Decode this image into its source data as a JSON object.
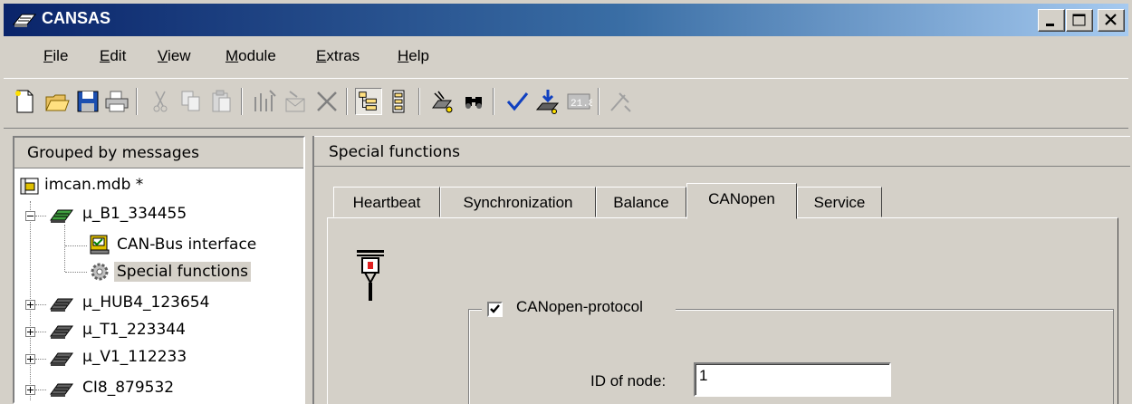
{
  "window": {
    "title": "CANSAS"
  },
  "menu": [
    {
      "label": "File",
      "accel": "F",
      "rest": "ile"
    },
    {
      "label": "Edit",
      "accel": "E",
      "rest": "dit"
    },
    {
      "label": "View",
      "accel": "V",
      "rest": "iew"
    },
    {
      "label": "Module",
      "accel": "M",
      "rest": "odule"
    },
    {
      "label": "Extras",
      "accel": "E",
      "rest": "xtras"
    },
    {
      "label": "Help",
      "accel": "H",
      "rest": "elp"
    }
  ],
  "toolbar": {
    "icons": [
      "new-file-icon",
      "open-folder-icon",
      "save-icon",
      "print-icon",
      "cut-icon",
      "copy-icon",
      "paste-icon",
      "add-module-icon",
      "import-icon",
      "delete-icon",
      "tree-view-icon",
      "list-view-icon",
      "find-module-icon",
      "binoculars-icon",
      "check-icon",
      "download-icon",
      "display-icon",
      "disabled-tool-icon"
    ],
    "pressed": "tree-view-icon"
  },
  "left_panel": {
    "header": "Grouped by messages",
    "tree": [
      {
        "label": "imcan.mdb *",
        "level": 0,
        "icon": "database-icon"
      },
      {
        "label": "µ_B1_334455",
        "level": 1,
        "expanded": true,
        "icon": "module-icon"
      },
      {
        "label": "CAN-Bus interface",
        "level": 2,
        "icon": "can-bus-icon"
      },
      {
        "label": "Special functions",
        "level": 2,
        "icon": "gear-icon",
        "selected": true
      },
      {
        "label": "µ_HUB4_123654",
        "level": 1,
        "expanded": false,
        "icon": "module-icon"
      },
      {
        "label": "µ_T1_223344",
        "level": 1,
        "expanded": false,
        "icon": "module-icon"
      },
      {
        "label": "µ_V1_112233",
        "level": 1,
        "expanded": false,
        "icon": "module-icon"
      },
      {
        "label": "CI8_879532",
        "level": 1,
        "expanded": false,
        "icon": "module-icon"
      }
    ]
  },
  "right_panel": {
    "header": "Special functions",
    "tabs": [
      "Heartbeat",
      "Synchronization",
      "Balance",
      "CANopen",
      "Service"
    ],
    "active_tab": "CANopen",
    "canopen": {
      "checkbox_label": "CANopen-protocol",
      "checked": true,
      "node_id_label": "ID of node:",
      "node_id_value": "1"
    }
  },
  "colors": {
    "title_start": "#0a246a",
    "title_end": "#a6caf0",
    "face": "#d4d0c8"
  }
}
